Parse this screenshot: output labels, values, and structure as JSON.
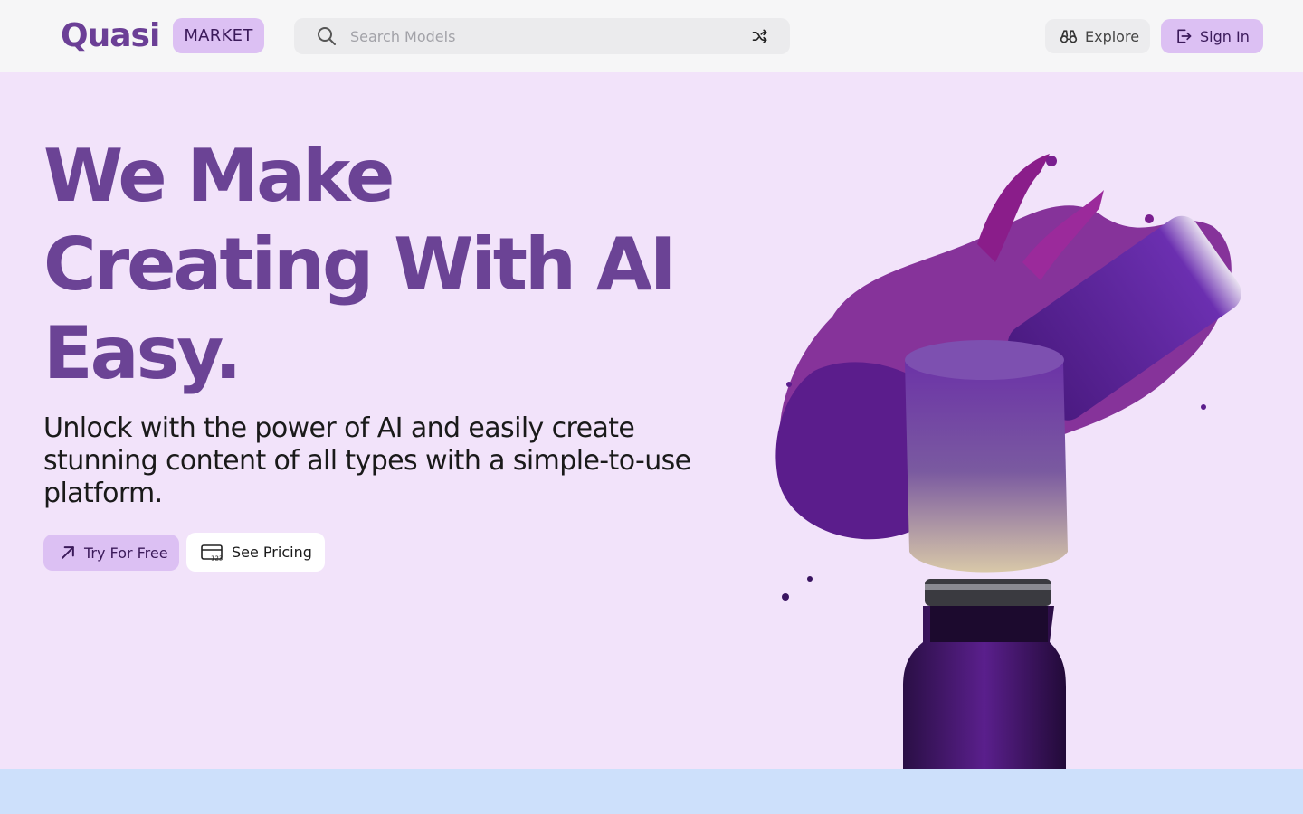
{
  "header": {
    "logo": "Quasi",
    "market_label": "MARKET",
    "search_placeholder": "Search Models",
    "explore_label": "Explore",
    "signin_label": "Sign In"
  },
  "hero": {
    "title_line1": "We Make",
    "title_line2": "Creating With AI",
    "title_line3": "Easy.",
    "subtitle": "Unlock with the power of AI and easily create stunning content of all types with a simple-to-use platform.",
    "try_label": "Try For Free",
    "pricing_label": "See Pricing",
    "pricing_icon_text": "123"
  },
  "icons": {
    "search": "search-icon",
    "shuffle": "shuffle-icon",
    "explore": "binoculars-icon",
    "signin": "sign-in-icon",
    "try": "arrow-up-right-icon",
    "pricing": "credit-card-icon"
  },
  "colors": {
    "brand": "#6b4395",
    "accent_pill": "#dcc0f3",
    "hero_bg": "#f2e3fa",
    "bottom_band": "#cde0fb"
  }
}
